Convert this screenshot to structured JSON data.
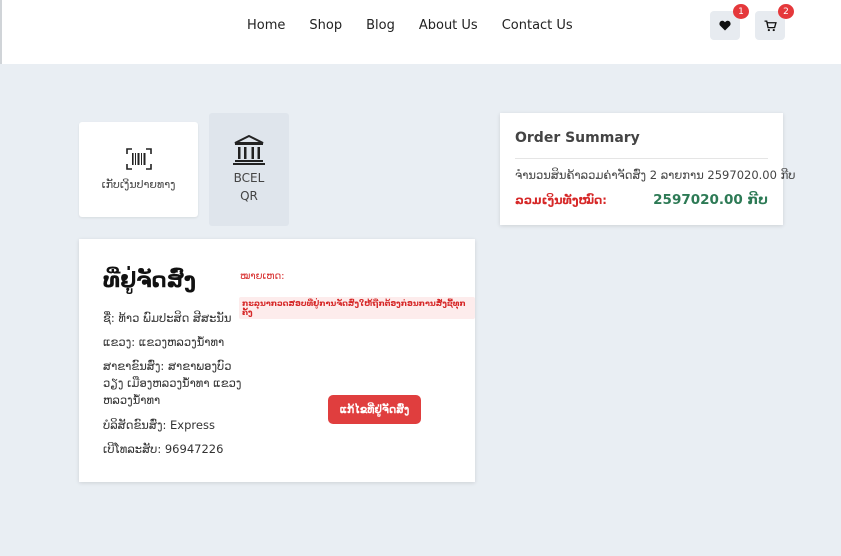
{
  "nav": {
    "items": [
      "Home",
      "Shop",
      "Blog",
      "About Us",
      "Contact Us"
    ],
    "wishlist_icon": "heart-icon",
    "wishlist_count": "1",
    "cart_icon": "cart-icon",
    "cart_count": "2"
  },
  "payment": {
    "options": [
      {
        "icon": "barcode-scan-icon",
        "label": "ເກັບເງິນປາຍທາງ",
        "selected": false
      },
      {
        "icon": "bank-icon",
        "label_line1": "BCEL",
        "label_line2": "QR",
        "selected": true
      }
    ]
  },
  "address": {
    "title": "ທີ່ຢູ່ຈັດສົ່ງ",
    "name": "ຊື່: ທ້າວ ພົມປະສິດ ສີສະນັນ",
    "province": "ແຂວງ: ແຂວງຫລວງນ້ຳທາ",
    "branch": "ສາຂາຂົນສົ່ງ: ສາຂາພອງບົວວຽງ ເມືອງຫລວງນ້ຳທາ ແຂວງຫລວງນ້ຳທາ",
    "courier": "ບໍລິສັດຂົນສົ່ງ: Express",
    "phone": "ເບີໂທລະສັບ: 96947226",
    "note_label": "ໝາຍເຫດ:",
    "note_text": "ກະລຸນາກວດສອບທີ່ຢູ່ການຈັດສົ່ງໃຫ້ຖືກຕ້ອງກ່ອນການສັ່ງຊື້ທຸກຄັ້ງ",
    "edit_button": "ແກ້ໄຂທີ່ຢູ່ຈັດສົ່ງ"
  },
  "summary": {
    "title": "Order Summary",
    "line": "ຈຳນວນສິນຄ້າລວມຄ່າຈັດສົ່ງ 2 ລາຍການ 2597020.00 ກີບ",
    "total_label": "ລວມເງິນທັງໝົດ:",
    "total_value": "2597020.00 ກີບ"
  },
  "colors": {
    "accent_red": "#e03e3e",
    "total_green": "#2d7a55",
    "page_bg": "#e9eef3"
  }
}
